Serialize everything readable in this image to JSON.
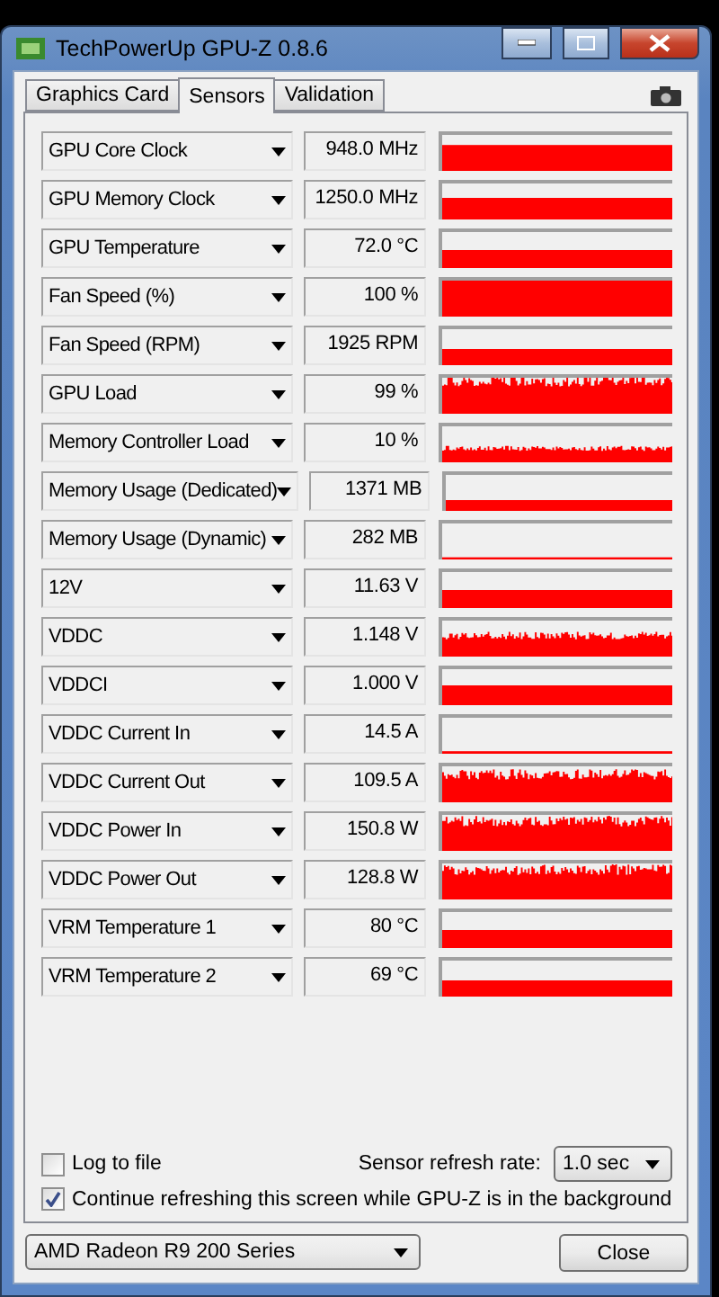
{
  "window": {
    "title": "TechPowerUp GPU-Z 0.8.6"
  },
  "tabs": [
    {
      "label": "Graphics Card",
      "selected": false
    },
    {
      "label": "Sensors",
      "selected": true
    },
    {
      "label": "Validation",
      "selected": false
    }
  ],
  "sensors": [
    {
      "name": "GPU Core Clock",
      "reading": "948.0 MHz",
      "kind": "flat"
    },
    {
      "name": "GPU Memory Clock",
      "reading": "1250.0 MHz",
      "kind": "flat"
    },
    {
      "name": "GPU Temperature",
      "reading": "72.0 °C",
      "kind": "flat"
    },
    {
      "name": "Fan Speed (%)",
      "reading": "100 %",
      "kind": "flat"
    },
    {
      "name": "Fan Speed (RPM)",
      "reading": "1925 RPM",
      "kind": "flat"
    },
    {
      "name": "GPU Load",
      "reading": "99 %",
      "kind": "noisy"
    },
    {
      "name": "Memory Controller Load",
      "reading": "10 %",
      "kind": "noisy"
    },
    {
      "name": "Memory Usage (Dedicated)",
      "reading": "1371 MB",
      "kind": "flat"
    },
    {
      "name": "Memory Usage (Dynamic)",
      "reading": "282 MB",
      "kind": "flat"
    },
    {
      "name": "12V",
      "reading": "11.63 V",
      "kind": "flat"
    },
    {
      "name": "VDDC",
      "reading": "1.148 V",
      "kind": "noisy"
    },
    {
      "name": "VDDCI",
      "reading": "1.000 V",
      "kind": "flat"
    },
    {
      "name": "VDDC Current In",
      "reading": "14.5 A",
      "kind": "flat"
    },
    {
      "name": "VDDC Current Out",
      "reading": "109.5 A",
      "kind": "noisy"
    },
    {
      "name": "VDDC Power In",
      "reading": "150.8 W",
      "kind": "noisy"
    },
    {
      "name": "VDDC Power Out",
      "reading": "128.8 W",
      "kind": "noisy"
    },
    {
      "name": "VRM Temperature 1",
      "reading": "80 °C",
      "kind": "flat"
    },
    {
      "name": "VRM Temperature 2",
      "reading": "69 °C",
      "kind": "flat"
    }
  ],
  "log_to_file": {
    "label": "Log to file",
    "checked": false
  },
  "refresh_rate": {
    "label": "Sensor refresh rate:",
    "value": "1.0 sec"
  },
  "continue_refreshing": {
    "label": "Continue refreshing this screen while GPU-Z is in the background",
    "checked": true
  },
  "gpu_select": {
    "value": "AMD Radeon R9 200 Series"
  },
  "close_button": {
    "label": "Close"
  }
}
